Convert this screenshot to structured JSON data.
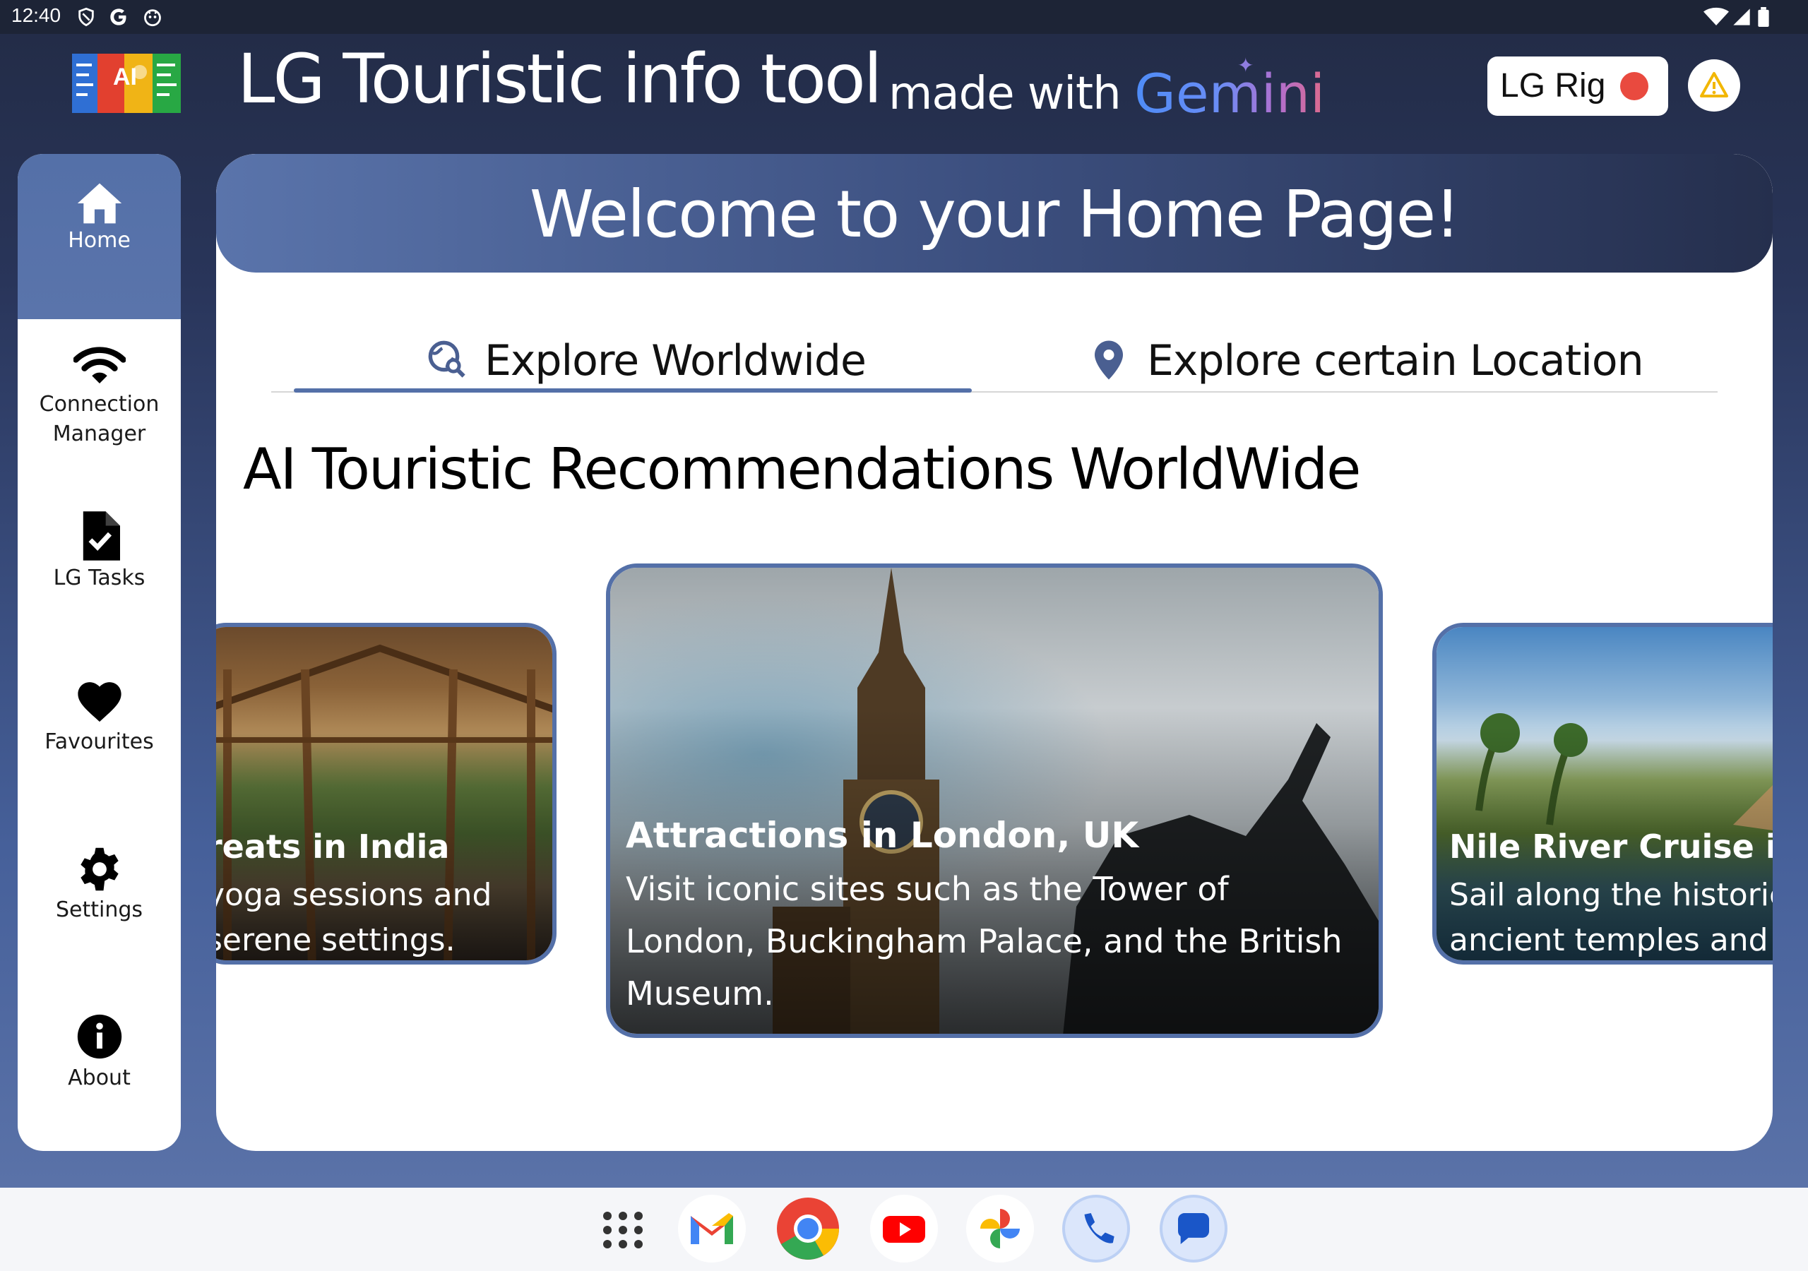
{
  "status_bar": {
    "time": "12:40"
  },
  "header": {
    "logo_text": "AI",
    "title": "LG Touristic info tool",
    "made_with": "made with",
    "brand": "Gemini",
    "rig_label": "LG Rig",
    "rig_status_color": "#e94a3f"
  },
  "sidebar": {
    "items": [
      {
        "label": "Home",
        "icon": "home-icon",
        "active": true
      },
      {
        "label": "Connection Manager",
        "icon": "wifi-icon",
        "active": false
      },
      {
        "label": "LG Tasks",
        "icon": "task-icon",
        "active": false
      },
      {
        "label": "Favourites",
        "icon": "heart-icon",
        "active": false
      },
      {
        "label": "Settings",
        "icon": "gear-icon",
        "active": false
      },
      {
        "label": "About",
        "icon": "info-icon",
        "active": false
      }
    ]
  },
  "main": {
    "banner": "Welcome to your Home Page!",
    "tabs": [
      {
        "label": "Explore Worldwide",
        "icon": "globe-search-icon",
        "active": true
      },
      {
        "label": "Explore certain Location",
        "icon": "location-pin-icon",
        "active": false
      }
    ],
    "section_title": "AI Touristic Recommendations WorldWide",
    "cards": [
      {
        "title": "reats in India",
        "desc_line1": "yoga sessions and",
        "desc_line2": "serene settings."
      },
      {
        "title": "Attractions in London, UK",
        "desc_line1": "Visit iconic sites such as the Tower of",
        "desc_line2": "London, Buckingham Palace, and the British",
        "desc_line3": "Museum."
      },
      {
        "title": "Nile River Cruise in Egy",
        "desc_line1": "Sail along the historic N",
        "desc_line2": "ancient temples and mo"
      }
    ]
  },
  "dock": {
    "apps": [
      "app-drawer-icon",
      "gmail-icon",
      "chrome-icon",
      "youtube-icon",
      "photos-icon",
      "phone-icon",
      "messages-icon"
    ]
  },
  "colors": {
    "accent": "#5470a8",
    "dark_navy": "#252f4d"
  }
}
